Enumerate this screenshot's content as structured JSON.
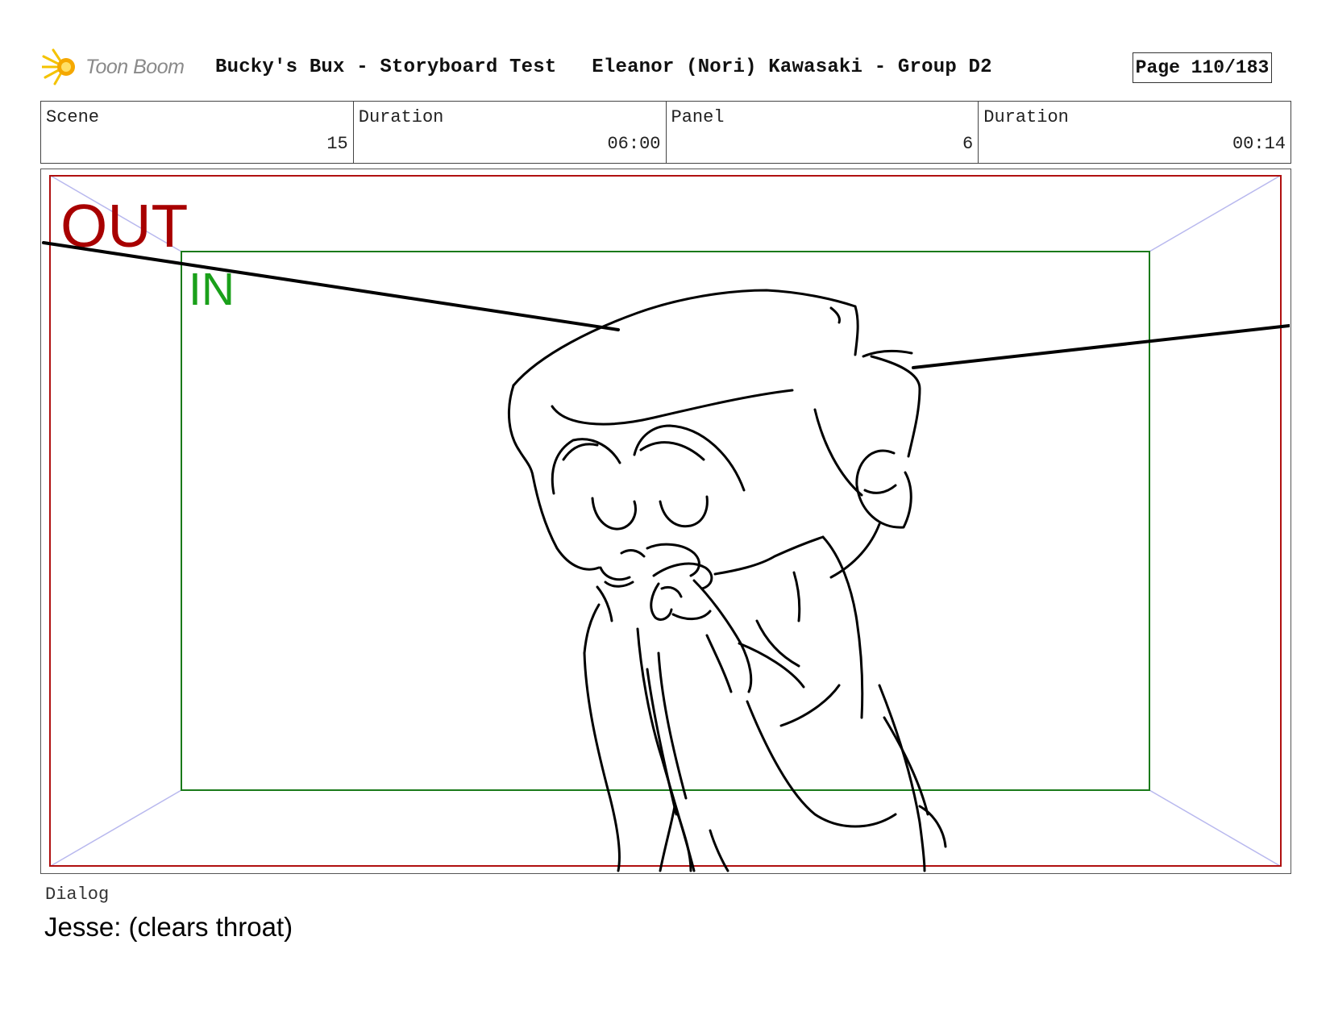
{
  "header": {
    "logo_text": "Toon Boom",
    "title": "Bucky's Bux - Storyboard Test   Eleanor (Nori) Kawasaki - Group D2",
    "page": "Page 110/183"
  },
  "meta": [
    {
      "label": "Scene",
      "value": "15"
    },
    {
      "label": "Duration",
      "value": "06:00"
    },
    {
      "label": "Panel",
      "value": "6"
    },
    {
      "label": "Duration",
      "value": "00:14"
    }
  ],
  "panel": {
    "out_label": "OUT",
    "in_label": "IN",
    "colors": {
      "out_frame": "#b01010",
      "in_frame": "#1a7a1a",
      "guides": "#b8b8ee",
      "out_text": "#a80000",
      "in_text": "#1aa01a"
    }
  },
  "dialog": {
    "label": "Dialog",
    "text": "Jesse: (clears throat)"
  }
}
